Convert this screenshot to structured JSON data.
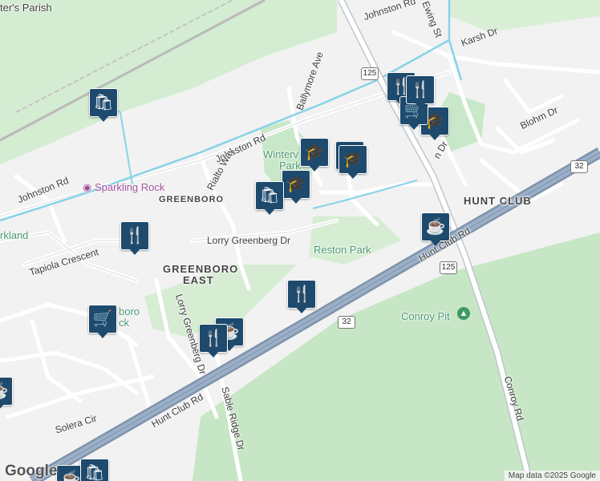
{
  "map": {
    "street_labels": [
      {
        "name": "johnston-rd-top",
        "text": "Johnston Rd"
      },
      {
        "name": "ewing-st",
        "text": "Ewing St"
      },
      {
        "name": "karsh-dr",
        "text": "Karsh Dr"
      },
      {
        "name": "ballymore-ave",
        "text": "Ballymore Ave"
      },
      {
        "name": "johnston-rd-mid",
        "text": "Johnston Rd"
      },
      {
        "name": "rialto-way",
        "text": "Rialto Way"
      },
      {
        "name": "johnston-rd-left",
        "text": "Johnston Rd"
      },
      {
        "name": "blohm-dr",
        "text": "Blohm Dr"
      },
      {
        "name": "dr-fragment",
        "text": "n Dr"
      },
      {
        "name": "lorry-greenberg-dr",
        "text": "Lorry Greenberg Dr"
      },
      {
        "name": "tapiola-crescent",
        "text": "Tapiola Crescent"
      },
      {
        "name": "hunt-club-rd-right",
        "text": "Hunt Club Rd"
      },
      {
        "name": "lorry-greenberg-dr-south",
        "text": "Lorry Greenberg Dr"
      },
      {
        "name": "hunt-club-rd-left",
        "text": "Hunt Club Rd"
      },
      {
        "name": "sable-ridge-dr",
        "text": "Sable Ridge Dr"
      },
      {
        "name": "solera-cir",
        "text": "Solera Cir"
      },
      {
        "name": "conroy-rd",
        "text": "Conroy Rd"
      }
    ],
    "area_labels": [
      {
        "name": "area-greenboro",
        "text": "GREENBORO"
      },
      {
        "name": "area-greenboro-east-1",
        "text": "GREENBORO"
      },
      {
        "name": "area-greenboro-east-2",
        "text": "EAST"
      },
      {
        "name": "area-hunt-club",
        "text": "HUNT CLUB"
      }
    ],
    "place_labels": [
      {
        "name": "place-parish",
        "text": "ter's Parish"
      },
      {
        "name": "place-sparkling-rock",
        "text": "Sparkling Rock"
      },
      {
        "name": "place-winterv-1",
        "text": "Winterv"
      },
      {
        "name": "place-winterv-2",
        "text": "Park"
      },
      {
        "name": "place-reston-park",
        "text": "Reston Park"
      },
      {
        "name": "place-parkland",
        "text": "rkland"
      },
      {
        "name": "place-boro-1",
        "text": "boro"
      },
      {
        "name": "place-boro-2",
        "text": "ck"
      },
      {
        "name": "place-conroy-pit",
        "text": "Conroy Pit"
      }
    ],
    "highway_shields": [
      "125",
      "32",
      "125",
      "32"
    ],
    "pois": [
      {
        "name": "shopping-bag-icon",
        "glyph": "🛍"
      },
      {
        "name": "restaurant-icon",
        "glyph": "🍴"
      },
      {
        "name": "restaurant-icon",
        "glyph": "🍴"
      },
      {
        "name": "shopping-cart-icon",
        "glyph": "🛒"
      },
      {
        "name": "school-icon",
        "glyph": "🎓"
      },
      {
        "name": "school-icon",
        "glyph": "🎓"
      },
      {
        "name": "school-icon",
        "glyph": "🎓"
      },
      {
        "name": "school-icon",
        "glyph": "🎓"
      },
      {
        "name": "shopping-bag-icon",
        "glyph": "🛍"
      },
      {
        "name": "school-icon",
        "glyph": "🎓"
      },
      {
        "name": "restaurant-icon",
        "glyph": "🍴"
      },
      {
        "name": "shopping-cart-icon",
        "glyph": "🛒"
      },
      {
        "name": "restaurant-icon",
        "glyph": "🍴"
      },
      {
        "name": "cafe-icon",
        "glyph": "☕"
      },
      {
        "name": "cafe-icon",
        "glyph": "☕"
      },
      {
        "name": "shopping-cart-icon",
        "glyph": "🛒"
      },
      {
        "name": "cafe-icon",
        "glyph": "☕"
      },
      {
        "name": "cafe-icon",
        "glyph": "☕"
      },
      {
        "name": "shopping-bag-icon",
        "glyph": "🛍"
      }
    ],
    "logo": "Google",
    "attribution": "Map data ©2025 Google",
    "colors": {
      "background": "#f2f2f2",
      "green": "#c9e8c9",
      "highway": "#8da1b9",
      "transit": "#86d3e8",
      "poi": "#1e4a6e"
    }
  }
}
